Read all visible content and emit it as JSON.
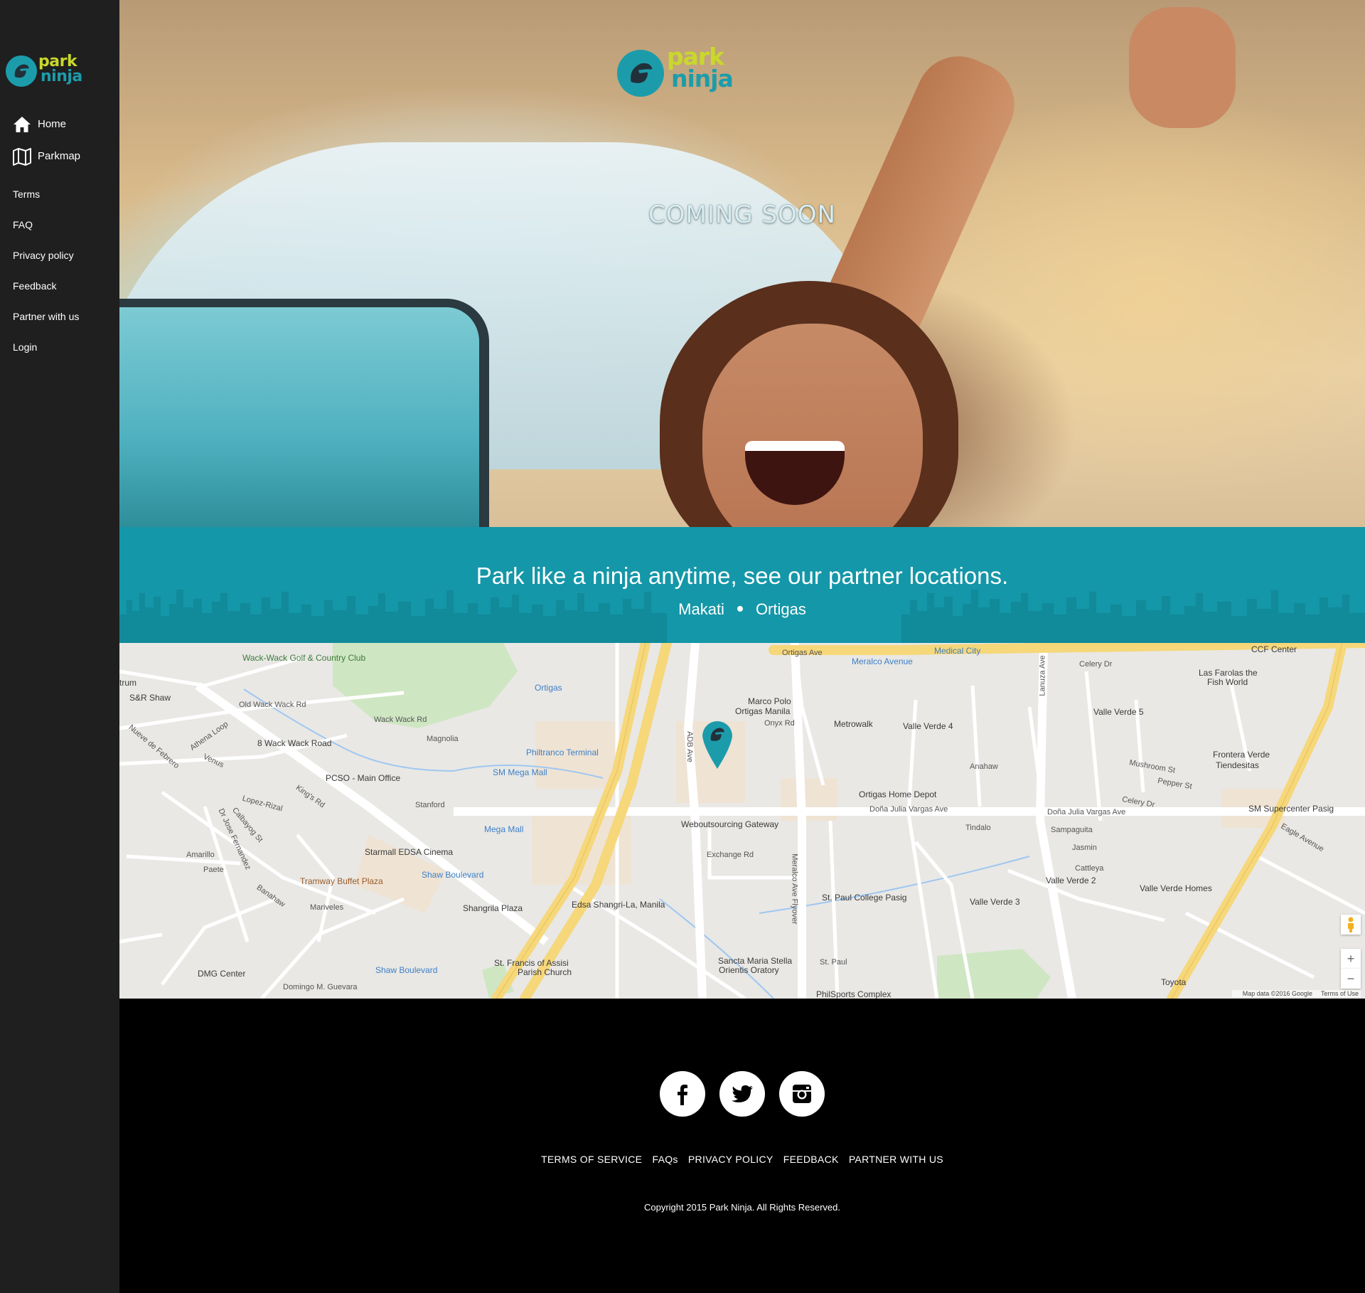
{
  "brand": {
    "line1": "park",
    "line2": "ninja",
    "colors": {
      "teal": "#1c9cab",
      "lime": "#c9d82b",
      "sidebar": "#1f1f1f"
    }
  },
  "sidebar": {
    "primary": [
      {
        "label": "Home",
        "icon": "home-icon"
      },
      {
        "label": "Parkmap",
        "icon": "map-icon"
      }
    ],
    "secondary": [
      {
        "label": "Terms"
      },
      {
        "label": "FAQ"
      },
      {
        "label": "Privacy policy"
      },
      {
        "label": "Feedback"
      },
      {
        "label": "Partner with us"
      },
      {
        "label": "Login"
      }
    ]
  },
  "hero": {
    "heading": "COMING SOON"
  },
  "band": {
    "headline": "Park like a ninja anytime, see our partner locations.",
    "cities": [
      "Makati",
      "Ortigas"
    ],
    "color": "#1497a8"
  },
  "map": {
    "labels": {
      "wackwack": "Wack-Wack Golf & Country Club",
      "ortigas_ave": "Ortigas Ave",
      "medical_city": "Medical City",
      "meralco_avenue": "Meralco Avenue",
      "ccf_center": "CCF Center",
      "celery_dr": "Celery Dr",
      "las_farolas": "Las Farolas the",
      "fish_world": "Fish World",
      "sr_shaw": "S&R Shaw",
      "trum": "trum",
      "old_wack_wack_rd": "Old Wack Wack Rd",
      "wack_wack_rd": "Wack Wack Rd",
      "ortigas_station": "Ortigas",
      "marco_polo": "Marco Polo",
      "ortigas_manila": "Ortigas Manila",
      "onyx_rd": "Onyx Rd",
      "metrowalk": "Metrowalk",
      "valle_verde_4": "Valle Verde 4",
      "valle_verde_5": "Valle Verde 5",
      "eight_wack_wack_rd": "8 Wack Wack Road",
      "magnolia": "Magnolia",
      "philtranco": "Philtranco Terminal",
      "sm_mega_mall": "SM Mega Mall",
      "pcso": "PCSO - Main Office",
      "stanford": "Stanford",
      "ortigas_home_depot": "Ortigas Home Depot",
      "frontera_verde": "Frontera Verde",
      "tiendesitas": "Tiendesitas",
      "sm_supercenter": "SM Supercenter Pasig",
      "webout": "Weboutsourcing Gateway",
      "dona_julia": "Doña Julia Vargas Ave",
      "dona_julia_2": "Doña Julia Vargas Ave",
      "mega_mall": "Mega Mall",
      "starmall": "Starmall EDSA Cinema",
      "exchange_rd": "Exchange Rd",
      "amarillo": "Amarillo",
      "paete": "Paete",
      "shaw_boulevard": "Shaw Boulevard",
      "tramway": "Tramway Buffet Plaza",
      "valle_verde_2": "Valle Verde 2",
      "valle_verde_homes": "Valle Verde Homes",
      "st_paul_college": "St. Paul College Pasig",
      "valle_verde_3": "Valle Verde 3",
      "shangrila_plaza": "Shangrila Plaza",
      "edsa_shangri": "Edsa Shangri-La, Manila",
      "mariveles": "Mariveles",
      "dmg_center": "DMG Center",
      "st_francis": "St. Francis of Assisi",
      "parish_church": "Parish Church",
      "sancta_maria": "Sancta Maria Stella",
      "orientis": "Orientis Oratory",
      "st_paul": "St. Paul",
      "philsports": "PhilSports Complex",
      "toyota": "Toyota",
      "domingo": "Domingo M. Guevara",
      "shaw_boulevard_2": "Shaw Boulevard",
      "adb_ave": "ADB Ave",
      "meralco_flyover": "Meralco Ave Flyover",
      "lanuza": "Lanuza Ave",
      "eagle_avenue": "Eagle Avenue",
      "lopez_rizal": "Lopez-Rizal",
      "athena": "Athena Loop",
      "nueve": "Nueve de Febrero",
      "venus": "Venus",
      "kings_rd": "King's Rd",
      "dr_jose": "Dr Jose Fernandez",
      "calbayog": "Calbayog St",
      "banahaw": "Banahaw",
      "sampaguita": "Sampaguita",
      "jasmin": "Jasmin",
      "cattleya": "Cattleya",
      "tindalo": "Tindalo",
      "anahaw": "Anahaw",
      "mushroom": "Mushroom St",
      "pepper": "Pepper St",
      "celery_dr2": "Celery Dr"
    },
    "zoom_in": "+",
    "zoom_out": "−",
    "attribution": "Map data ©2016 Google",
    "terms": "Terms of Use"
  },
  "footer": {
    "socials": [
      {
        "name": "facebook-icon"
      },
      {
        "name": "twitter-icon"
      },
      {
        "name": "instagram-icon"
      }
    ],
    "links": [
      "TERMS OF SERVICE",
      "FAQs",
      "PRIVACY POLICY",
      "FEEDBACK",
      "PARTNER WITH US"
    ],
    "copyright": "Copyright 2015 Park Ninja. All Rights Reserved."
  }
}
